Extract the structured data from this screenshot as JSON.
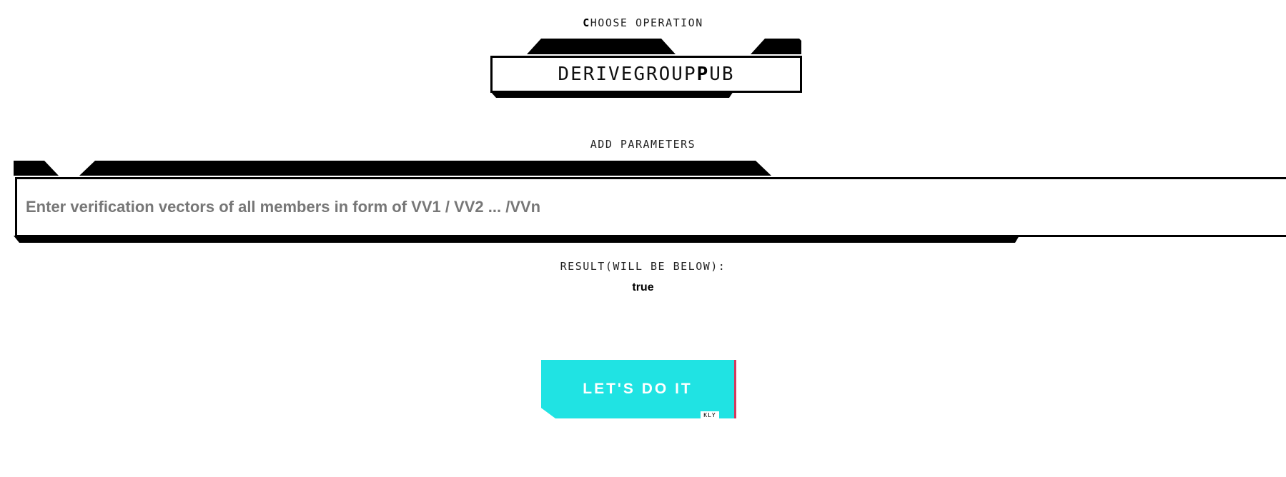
{
  "operation": {
    "section_label_first": "C",
    "section_label_rest": "HOOSE OPERATION",
    "selected_before": "DERIVEGROUP",
    "selected_bold": "P",
    "selected_after": "UB"
  },
  "parameters": {
    "section_label": "ADD PARAMETERS",
    "input_placeholder": "Enter verification vectors of all members in form of VV1 / VV2 ... /VVn",
    "input_value": ""
  },
  "result": {
    "label": "RESULT(WILL BE BELOW):",
    "value": "true"
  },
  "action": {
    "button_label": "LET'S DO IT",
    "tag": "KLY"
  },
  "colors": {
    "button_bg": "#20e3e3",
    "button_edge": "#d23b5e",
    "frame": "#000000"
  }
}
